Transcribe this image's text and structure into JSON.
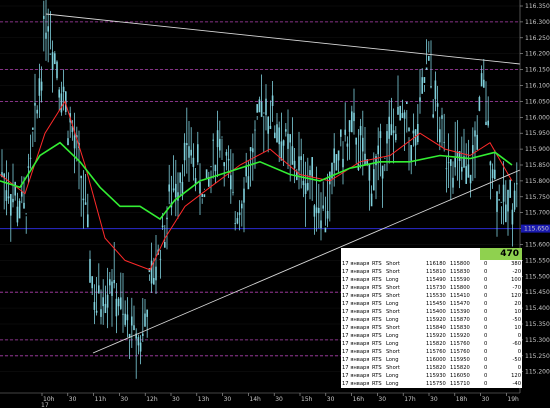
{
  "price_axis": {
    "labels": [
      "116.350",
      "116.300",
      "116.250",
      "116.200",
      "116.150",
      "116.100",
      "116.050",
      "116.000",
      "115.950",
      "115.900",
      "115.850",
      "115.800",
      "115.750",
      "115.700",
      "115.650",
      "115.600",
      "115.550",
      "115.500",
      "115.450",
      "115.400",
      "115.350",
      "115.300",
      "115.250",
      "115.200"
    ],
    "current_price": "115.650"
  },
  "time_axis": {
    "labels": [
      "10h",
      "30",
      "11h",
      "30",
      "12h",
      "30",
      "13h",
      "30",
      "14h",
      "30",
      "15h",
      "30",
      "16h",
      "30",
      "17h",
      "30",
      "18h",
      "30",
      "19h"
    ],
    "date_label": "17"
  },
  "colors": {
    "background": "#000000",
    "candles": "#7fd0dc",
    "ma_fast": "#ff2a2a",
    "ma_slow": "#33ee33",
    "trendline": "#d8d8d8",
    "level_dashed": "#b040b0",
    "current_price_line": "#2a2ad0",
    "total_badge": "#8fd14f"
  },
  "trades": {
    "total": "470",
    "rows": [
      {
        "date": "17 января",
        "symbol": "RTS",
        "side": "Short",
        "price1": "116180",
        "price2": "115800",
        "zero": "0",
        "pnl": "380"
      },
      {
        "date": "17 января",
        "symbol": "RTS",
        "side": "Short",
        "price1": "115810",
        "price2": "115830",
        "zero": "0",
        "pnl": "-20"
      },
      {
        "date": "17 января",
        "symbol": "RTS",
        "side": "Long",
        "price1": "115490",
        "price2": "115590",
        "zero": "0",
        "pnl": "100"
      },
      {
        "date": "17 января",
        "symbol": "RTS",
        "side": "Short",
        "price1": "115730",
        "price2": "115800",
        "zero": "0",
        "pnl": "-70"
      },
      {
        "date": "17 января",
        "symbol": "RTS",
        "side": "Short",
        "price1": "115530",
        "price2": "115410",
        "zero": "0",
        "pnl": "120"
      },
      {
        "date": "17 января",
        "symbol": "RTS",
        "side": "Long",
        "price1": "115450",
        "price2": "115470",
        "zero": "0",
        "pnl": "20"
      },
      {
        "date": "17 января",
        "symbol": "RTS",
        "side": "Short",
        "price1": "115400",
        "price2": "115390",
        "zero": "0",
        "pnl": "10"
      },
      {
        "date": "17 января",
        "symbol": "RTS",
        "side": "Long",
        "price1": "115920",
        "price2": "115870",
        "zero": "0",
        "pnl": "-50"
      },
      {
        "date": "17 января",
        "symbol": "RTS",
        "side": "Short",
        "price1": "115840",
        "price2": "115830",
        "zero": "0",
        "pnl": "10"
      },
      {
        "date": "17 января",
        "symbol": "RTS",
        "side": "Long",
        "price1": "115920",
        "price2": "115920",
        "zero": "0",
        "pnl": "0"
      },
      {
        "date": "17 января",
        "symbol": "RTS",
        "side": "Long",
        "price1": "115820",
        "price2": "115760",
        "zero": "0",
        "pnl": "-60"
      },
      {
        "date": "17 января",
        "symbol": "RTS",
        "side": "Short",
        "price1": "115760",
        "price2": "115760",
        "zero": "0",
        "pnl": "0"
      },
      {
        "date": "17 января",
        "symbol": "RTS",
        "side": "Long",
        "price1": "116000",
        "price2": "115950",
        "zero": "0",
        "pnl": "-50"
      },
      {
        "date": "17 января",
        "symbol": "RTS",
        "side": "Short",
        "price1": "115820",
        "price2": "115820",
        "zero": "0",
        "pnl": "0"
      },
      {
        "date": "17 января",
        "symbol": "RTS",
        "side": "Long",
        "price1": "115930",
        "price2": "116050",
        "zero": "0",
        "pnl": "120"
      },
      {
        "date": "17 января",
        "symbol": "RTS",
        "side": "Long",
        "price1": "115750",
        "price2": "115710",
        "zero": "0",
        "pnl": "-40"
      }
    ]
  }
}
